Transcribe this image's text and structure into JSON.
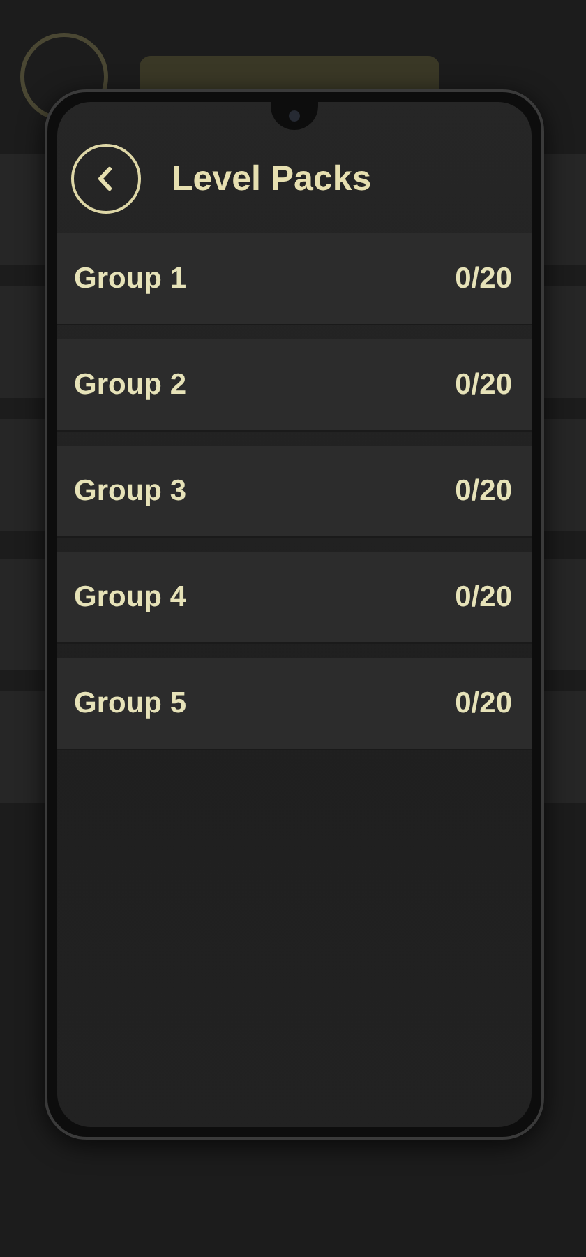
{
  "header": {
    "title": "Level Packs"
  },
  "groups": [
    {
      "name": "Group 1",
      "progress": "0/20"
    },
    {
      "name": "Group 2",
      "progress": "0/20"
    },
    {
      "name": "Group 3",
      "progress": "0/20"
    },
    {
      "name": "Group 4",
      "progress": "0/20"
    },
    {
      "name": "Group 5",
      "progress": "0/20"
    }
  ]
}
